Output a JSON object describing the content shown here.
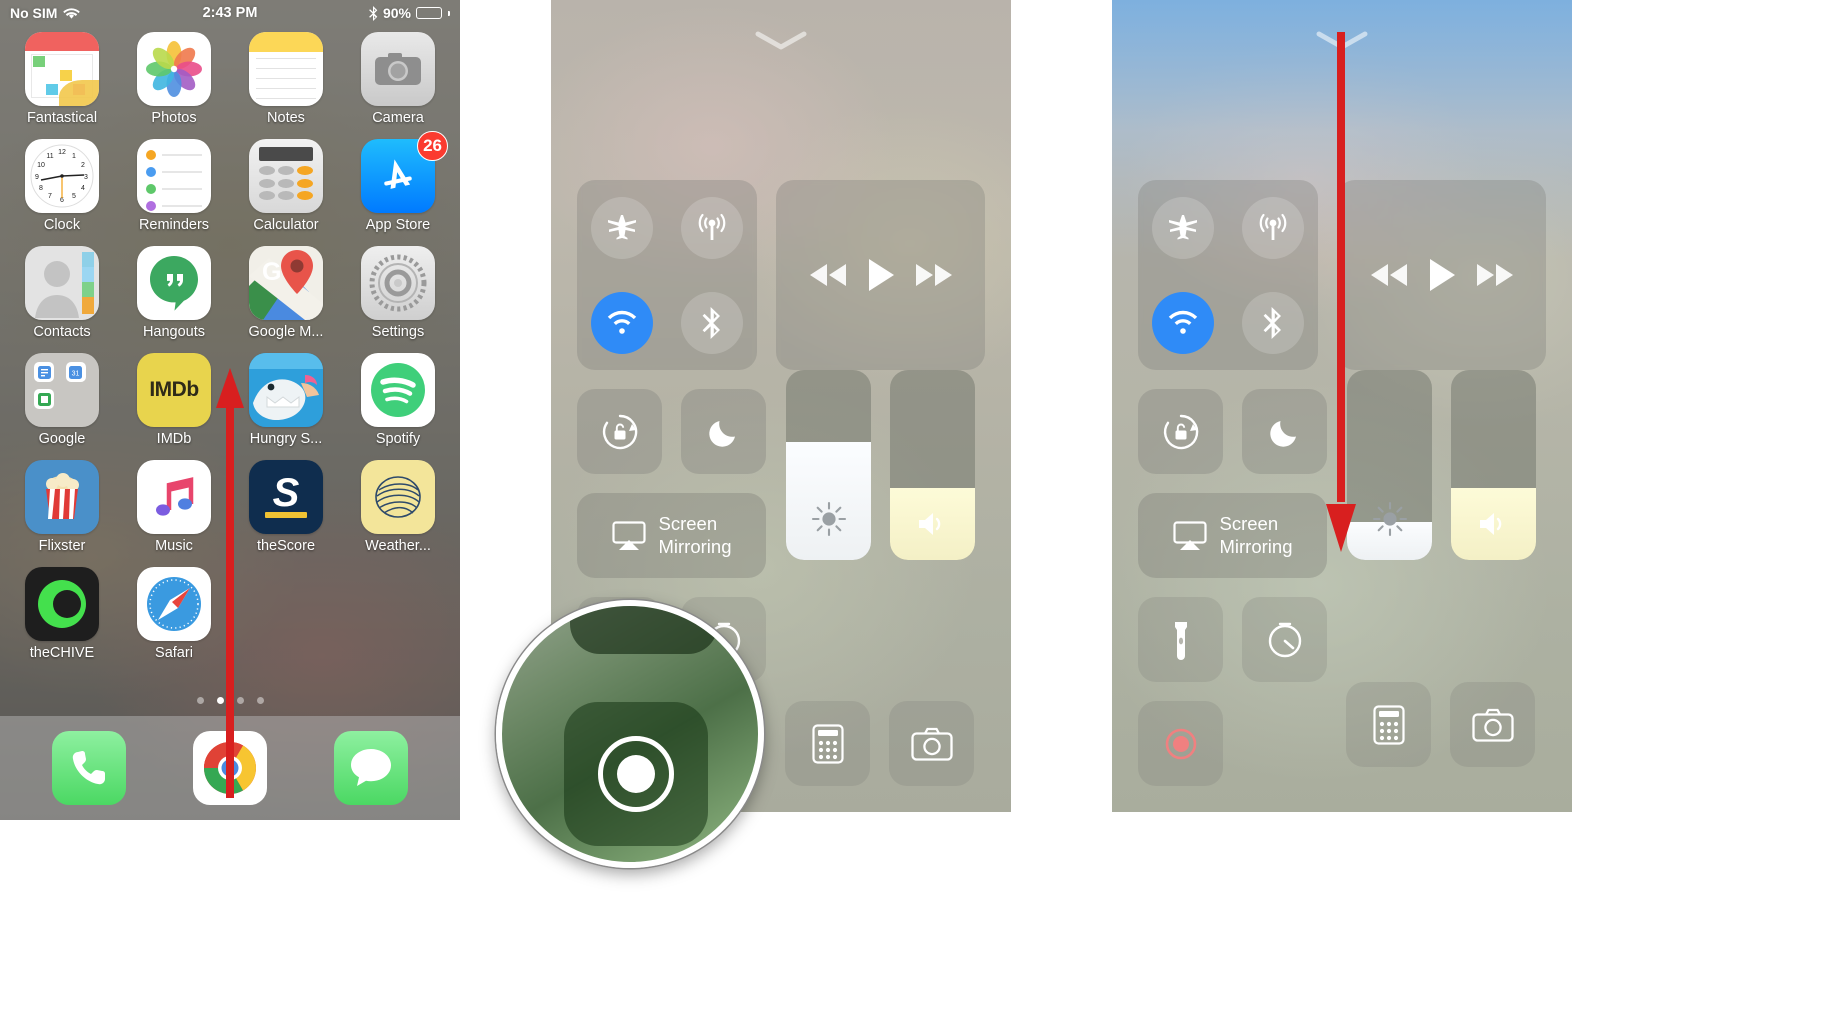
{
  "accent": {
    "arrow_red": "#d81f1f",
    "toggle_on_blue": "#2f8bf7",
    "badge_red": "#fb3b30",
    "record_red": "#f08080"
  },
  "panel1": {
    "name": "home-screen",
    "status_bar": {
      "carrier": "No SIM",
      "wifi_icon": "wifi-icon",
      "time": "2:43 PM",
      "bluetooth_icon": "bluetooth-icon",
      "battery_percent": "90%",
      "battery_icon": "battery-icon"
    },
    "apps": [
      {
        "label": "Fantastical",
        "icon": "fantastical-icon",
        "badge": null
      },
      {
        "label": "Photos",
        "icon": "photos-icon",
        "badge": null
      },
      {
        "label": "Notes",
        "icon": "notes-icon",
        "badge": null
      },
      {
        "label": "Camera",
        "icon": "camera-icon",
        "badge": null
      },
      {
        "label": "Clock",
        "icon": "clock-icon",
        "badge": null
      },
      {
        "label": "Reminders",
        "icon": "reminders-icon",
        "badge": null
      },
      {
        "label": "Calculator",
        "icon": "calculator-icon",
        "badge": null
      },
      {
        "label": "App Store",
        "icon": "app-store-icon",
        "badge": "26"
      },
      {
        "label": "Contacts",
        "icon": "contacts-icon",
        "badge": null
      },
      {
        "label": "Hangouts",
        "icon": "hangouts-icon",
        "badge": null
      },
      {
        "label": "Google M...",
        "icon": "google-maps-icon",
        "badge": null
      },
      {
        "label": "Settings",
        "icon": "settings-icon",
        "badge": null
      },
      {
        "label": "Google",
        "icon": "google-folder-icon",
        "badge": null
      },
      {
        "label": "IMDb",
        "icon": "imdb-icon",
        "badge": null
      },
      {
        "label": "Hungry S...",
        "icon": "hungry-shark-icon",
        "badge": null
      },
      {
        "label": "Spotify",
        "icon": "spotify-icon",
        "badge": null
      },
      {
        "label": "Flixster",
        "icon": "flixster-icon",
        "badge": null
      },
      {
        "label": "Music",
        "icon": "music-icon",
        "badge": null
      },
      {
        "label": "theScore",
        "icon": "thescore-icon",
        "badge": null
      },
      {
        "label": "Weather...",
        "icon": "weather-icon",
        "badge": null
      },
      {
        "label": "theCHIVE",
        "icon": "thechive-icon",
        "badge": null
      },
      {
        "label": "Safari",
        "icon": "safari-icon",
        "badge": null
      }
    ],
    "imdb_wordmark": "IMDb",
    "thescore_wordmark": "S",
    "page_dots": {
      "count": 4,
      "active_index": 1
    },
    "dock": [
      {
        "label": "Phone",
        "icon": "phone-icon"
      },
      {
        "label": "Chrome",
        "icon": "chrome-icon"
      },
      {
        "label": "Messages",
        "icon": "messages-icon"
      }
    ],
    "gesture": {
      "name": "swipe-up-arrow",
      "direction": "up",
      "hint": "Swipe up from the bottom of the screen"
    }
  },
  "panel2": {
    "name": "control-center-collapsed",
    "handle_icon": "chevron-down-handle-icon",
    "toggles": [
      {
        "label": "Airplane Mode",
        "icon": "airplane-icon",
        "state": "off"
      },
      {
        "label": "Cellular Data",
        "icon": "cellular-data-icon",
        "state": "off"
      },
      {
        "label": "Wi-Fi",
        "icon": "wifi-icon",
        "state": "on"
      },
      {
        "label": "Bluetooth",
        "icon": "bluetooth-icon",
        "state": "off"
      }
    ],
    "media": [
      {
        "label": "Rewind",
        "icon": "rewind-icon"
      },
      {
        "label": "Play",
        "icon": "play-icon"
      },
      {
        "label": "Fast Forward",
        "icon": "fast-forward-icon"
      }
    ],
    "second_row": [
      {
        "label": "Rotation Lock",
        "icon": "rotation-lock-icon"
      },
      {
        "label": "Do Not Disturb",
        "icon": "moon-icon"
      }
    ],
    "sliders": [
      {
        "label": "Brightness",
        "icon": "brightness-sun-icon",
        "value_percent": 62
      },
      {
        "label": "Volume",
        "icon": "volume-icon",
        "value_percent": 38
      }
    ],
    "screen_mirroring": {
      "line1": "Screen",
      "line2": "Mirroring",
      "icon": "airplay-icon"
    },
    "bottom_row": [
      {
        "label": "Flashlight",
        "icon": "flashlight-icon"
      },
      {
        "label": "Timer",
        "icon": "timer-icon"
      },
      {
        "label": "Calculator",
        "icon": "calculator-icon"
      },
      {
        "label": "Camera",
        "icon": "camera-icon"
      }
    ],
    "magnifier": {
      "name": "screen-recording-magnifier",
      "target_icon": "screen-record-icon",
      "description": "Magnified view of the Screen Recording button"
    }
  },
  "panel3": {
    "name": "control-center-expanded",
    "handle_icon": "chevron-down-handle-icon",
    "toggles": [
      {
        "label": "Airplane Mode",
        "icon": "airplane-icon",
        "state": "off"
      },
      {
        "label": "Cellular Data",
        "icon": "cellular-data-icon",
        "state": "off"
      },
      {
        "label": "Wi-Fi",
        "icon": "wifi-icon",
        "state": "on"
      },
      {
        "label": "Bluetooth",
        "icon": "bluetooth-icon",
        "state": "off"
      }
    ],
    "media": [
      {
        "label": "Rewind",
        "icon": "rewind-icon"
      },
      {
        "label": "Play",
        "icon": "play-icon"
      },
      {
        "label": "Fast Forward",
        "icon": "fast-forward-icon"
      }
    ],
    "second_row": [
      {
        "label": "Rotation Lock",
        "icon": "rotation-lock-icon"
      },
      {
        "label": "Do Not Disturb",
        "icon": "moon-icon"
      }
    ],
    "sliders": [
      {
        "label": "Brightness",
        "icon": "brightness-sun-icon",
        "value_percent": 20
      },
      {
        "label": "Volume",
        "icon": "volume-icon",
        "value_percent": 38
      }
    ],
    "screen_mirroring": {
      "line1": "Screen",
      "line2": "Mirroring",
      "icon": "airplay-icon"
    },
    "bottom_row": [
      {
        "label": "Flashlight",
        "icon": "flashlight-icon"
      },
      {
        "label": "Timer",
        "icon": "timer-icon"
      },
      {
        "label": "Calculator",
        "icon": "calculator-icon"
      },
      {
        "label": "Camera",
        "icon": "camera-icon"
      }
    ],
    "record_button": {
      "label": "Screen Recording",
      "icon": "screen-record-icon",
      "state": "idle"
    },
    "gesture": {
      "name": "swipe-down-arrow",
      "direction": "down",
      "hint": "Drag down to the brightness slider"
    }
  }
}
